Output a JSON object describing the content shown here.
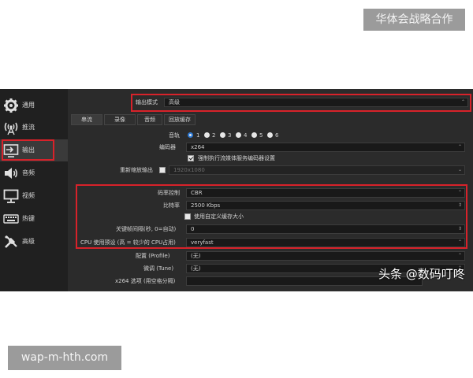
{
  "overlay": {
    "top_badge": "华体会战略合作",
    "bottom_badge": "wap-m-hth.com",
    "watermark": "头条 @数码叮咚"
  },
  "sidebar": {
    "items": [
      {
        "label": "通用",
        "icon": "gear-icon"
      },
      {
        "label": "推流",
        "icon": "broadcast-icon"
      },
      {
        "label": "输出",
        "icon": "output-icon",
        "active": true
      },
      {
        "label": "音频",
        "icon": "speaker-icon"
      },
      {
        "label": "视频",
        "icon": "monitor-icon"
      },
      {
        "label": "热键",
        "icon": "keyboard-icon"
      },
      {
        "label": "高级",
        "icon": "tools-icon"
      }
    ]
  },
  "output_mode": {
    "label": "输出模式",
    "value": "高级"
  },
  "tabs": [
    "串流",
    "录像",
    "音频",
    "回放缓存"
  ],
  "audio_track": {
    "label": "音轨",
    "options": [
      "1",
      "2",
      "3",
      "4",
      "5",
      "6"
    ],
    "selected": "1"
  },
  "encoder": {
    "label": "编码器",
    "value": "x264"
  },
  "enforce_encoder_settings": {
    "label": "强制执行流媒体服务编码器设置",
    "checked": true
  },
  "rescale_output": {
    "label": "重新缩放输出",
    "value": "1920x1080",
    "checked": false
  },
  "rate_control": {
    "label": "码率控制",
    "value": "CBR"
  },
  "bitrate": {
    "label": "比特率",
    "value": "2500 Kbps"
  },
  "custom_buffer": {
    "label": "使用自定义缓存大小",
    "checked": false
  },
  "keyframe_interval": {
    "label": "关键帧间隔(秒, 0=自动)",
    "value": "0"
  },
  "cpu_preset": {
    "label": "CPU 使用预设 (高 = 较少的 CPU占用)",
    "value": "veryfast"
  },
  "profile": {
    "label": "配置 (Profile)",
    "value": "(无)"
  },
  "tune": {
    "label": "微调 (Tune)",
    "value": "(无)"
  },
  "x264_options": {
    "label": "x264 选项 (用空格分隔)",
    "value": ""
  },
  "colors": {
    "highlight_border": "#d8222a",
    "panel_bg": "#2b2b2b",
    "sidebar_bg": "#202020",
    "field_bg": "#191919"
  }
}
